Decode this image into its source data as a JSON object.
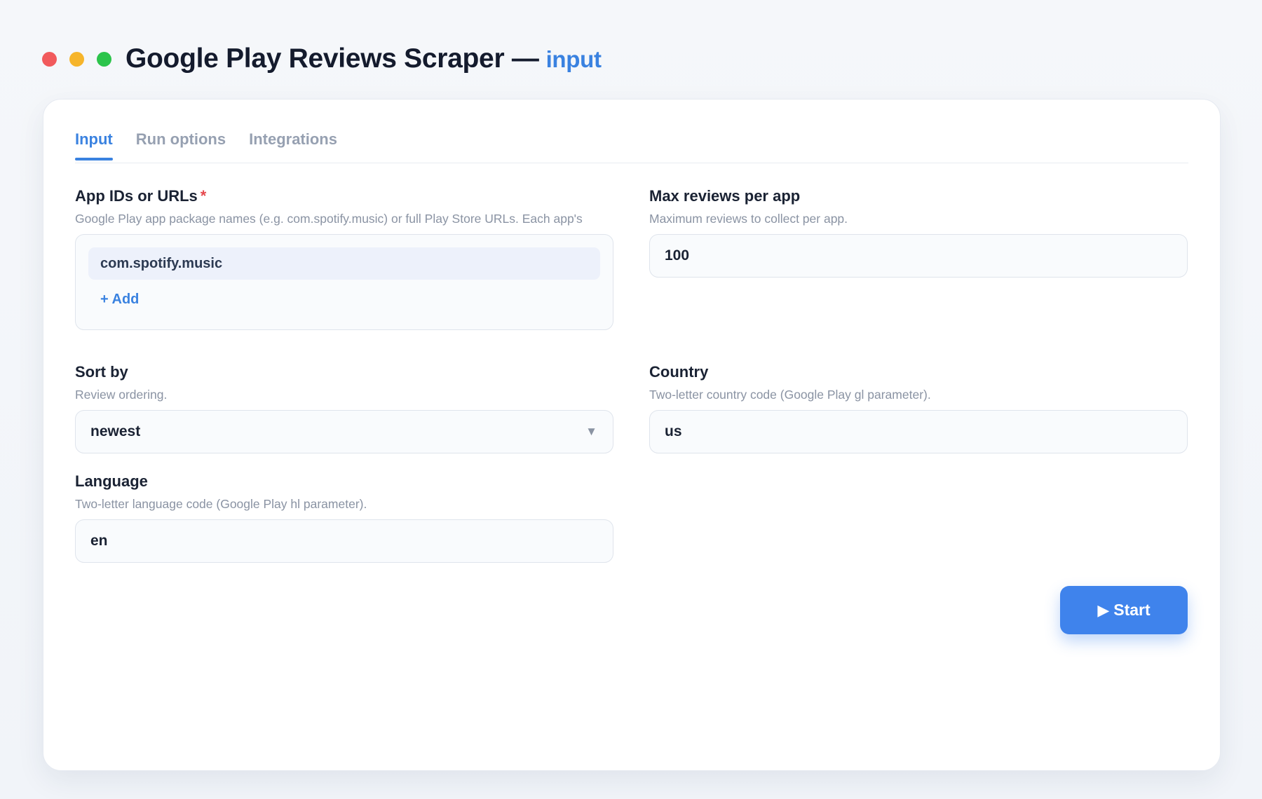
{
  "window": {
    "title": "Google Play Reviews Scraper —",
    "title_suffix": "input"
  },
  "tabs": [
    {
      "label": "Input",
      "active": true
    },
    {
      "label": "Run options",
      "active": false
    },
    {
      "label": "Integrations",
      "active": false
    }
  ],
  "fields": {
    "app_ids": {
      "label": "App IDs or URLs",
      "required_mark": "*",
      "help": "Google Play app package names (e.g. com.spotify.music) or full Play Store URLs. Each app's",
      "items": [
        "com.spotify.music"
      ],
      "add_label": "+ Add"
    },
    "max_reviews": {
      "label": "Max reviews per app",
      "help": "Maximum reviews to collect per app.",
      "value": "100"
    },
    "sort_by": {
      "label": "Sort by",
      "help": "Review ordering.",
      "value": "newest"
    },
    "country": {
      "label": "Country",
      "help": "Two-letter country code (Google Play gl parameter).",
      "value": "us"
    },
    "language": {
      "label": "Language",
      "help": "Two-letter language code (Google Play hl parameter).",
      "value": "en"
    }
  },
  "actions": {
    "start_icon": "▶",
    "start_label": "Start"
  },
  "colors": {
    "accent": "#3a82e0",
    "button": "#3f83ec",
    "required": "#e5484d",
    "traffic_red": "#f15a5c",
    "traffic_yellow": "#f6b52b",
    "traffic_green": "#2cc44b"
  }
}
